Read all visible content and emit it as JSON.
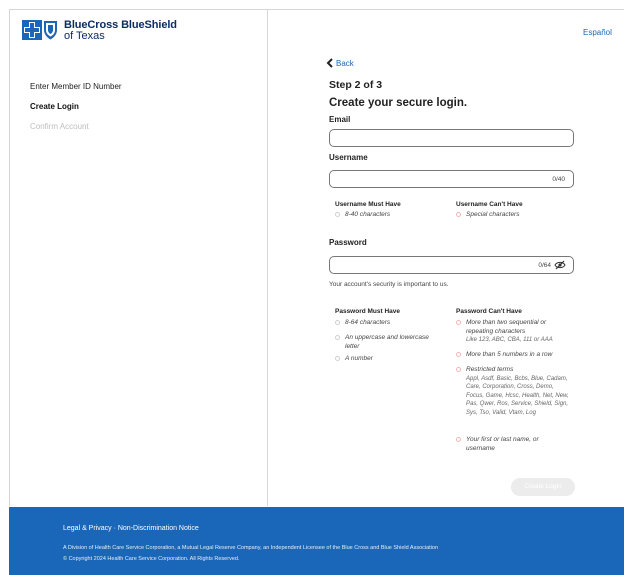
{
  "header": {
    "brand_line1": "BlueCross BlueShield",
    "brand_line2": "of Texas",
    "language_link": "Español"
  },
  "steps": [
    "Enter Member ID Number",
    "Create Login",
    "Confirm Account"
  ],
  "form": {
    "back_label": "Back",
    "step": "Step 2 of 3",
    "title": "Create your secure login.",
    "email_label": "Email",
    "email_value": "",
    "username_label": "Username",
    "username_counter": "0/40",
    "username_must_title": "Username Must Have",
    "username_must": [
      "8-40 characters"
    ],
    "username_cant_title": "Username Can't Have",
    "username_cant": [
      "Special characters"
    ],
    "password_label": "Password",
    "password_counter": "0/64",
    "security_note": "Your account's security is important to us.",
    "password_must_title": "Password Must Have",
    "password_must": [
      "8-64 characters",
      "An uppercase and lowercase letter",
      "A number"
    ],
    "password_cant_title": "Password Can't Have",
    "password_cant": [
      {
        "text": "More than two sequential or repeating characters",
        "sub": "Like 123, ABC, CBA, 111 or AAA"
      },
      {
        "text": "More than 5 numbers in a row",
        "sub": ""
      },
      {
        "text": "Restricted terms",
        "sub": "Appl, Asdf, Basic, Bcbs, Blue, Cadam, Care, Corporation, Cross, Demo, Focus, Game, Hcsc, Health, Net, New, Pas, Qwer, Ros, Service, Shield, Sign, Sys, Tso, Valid, Vtam, Log"
      },
      {
        "text": "Your first or last name, or username",
        "sub": ""
      }
    ],
    "submit_label": "Create Login"
  },
  "footer": {
    "links": "Legal & Privacy · Non-Discrimination Notice",
    "line1": "A Division of Health Care Service Corporation, a Mutual Legal Reserve Company, an Independent Licensee of the Blue Cross and Blue Shield Association",
    "line2": "© Copyright 2024 Health Care Service Corporation. All Rights Reserved."
  },
  "colors": {
    "brand": "#1a66b8",
    "navy": "#0b2d63",
    "footer": "#1a66b8"
  }
}
